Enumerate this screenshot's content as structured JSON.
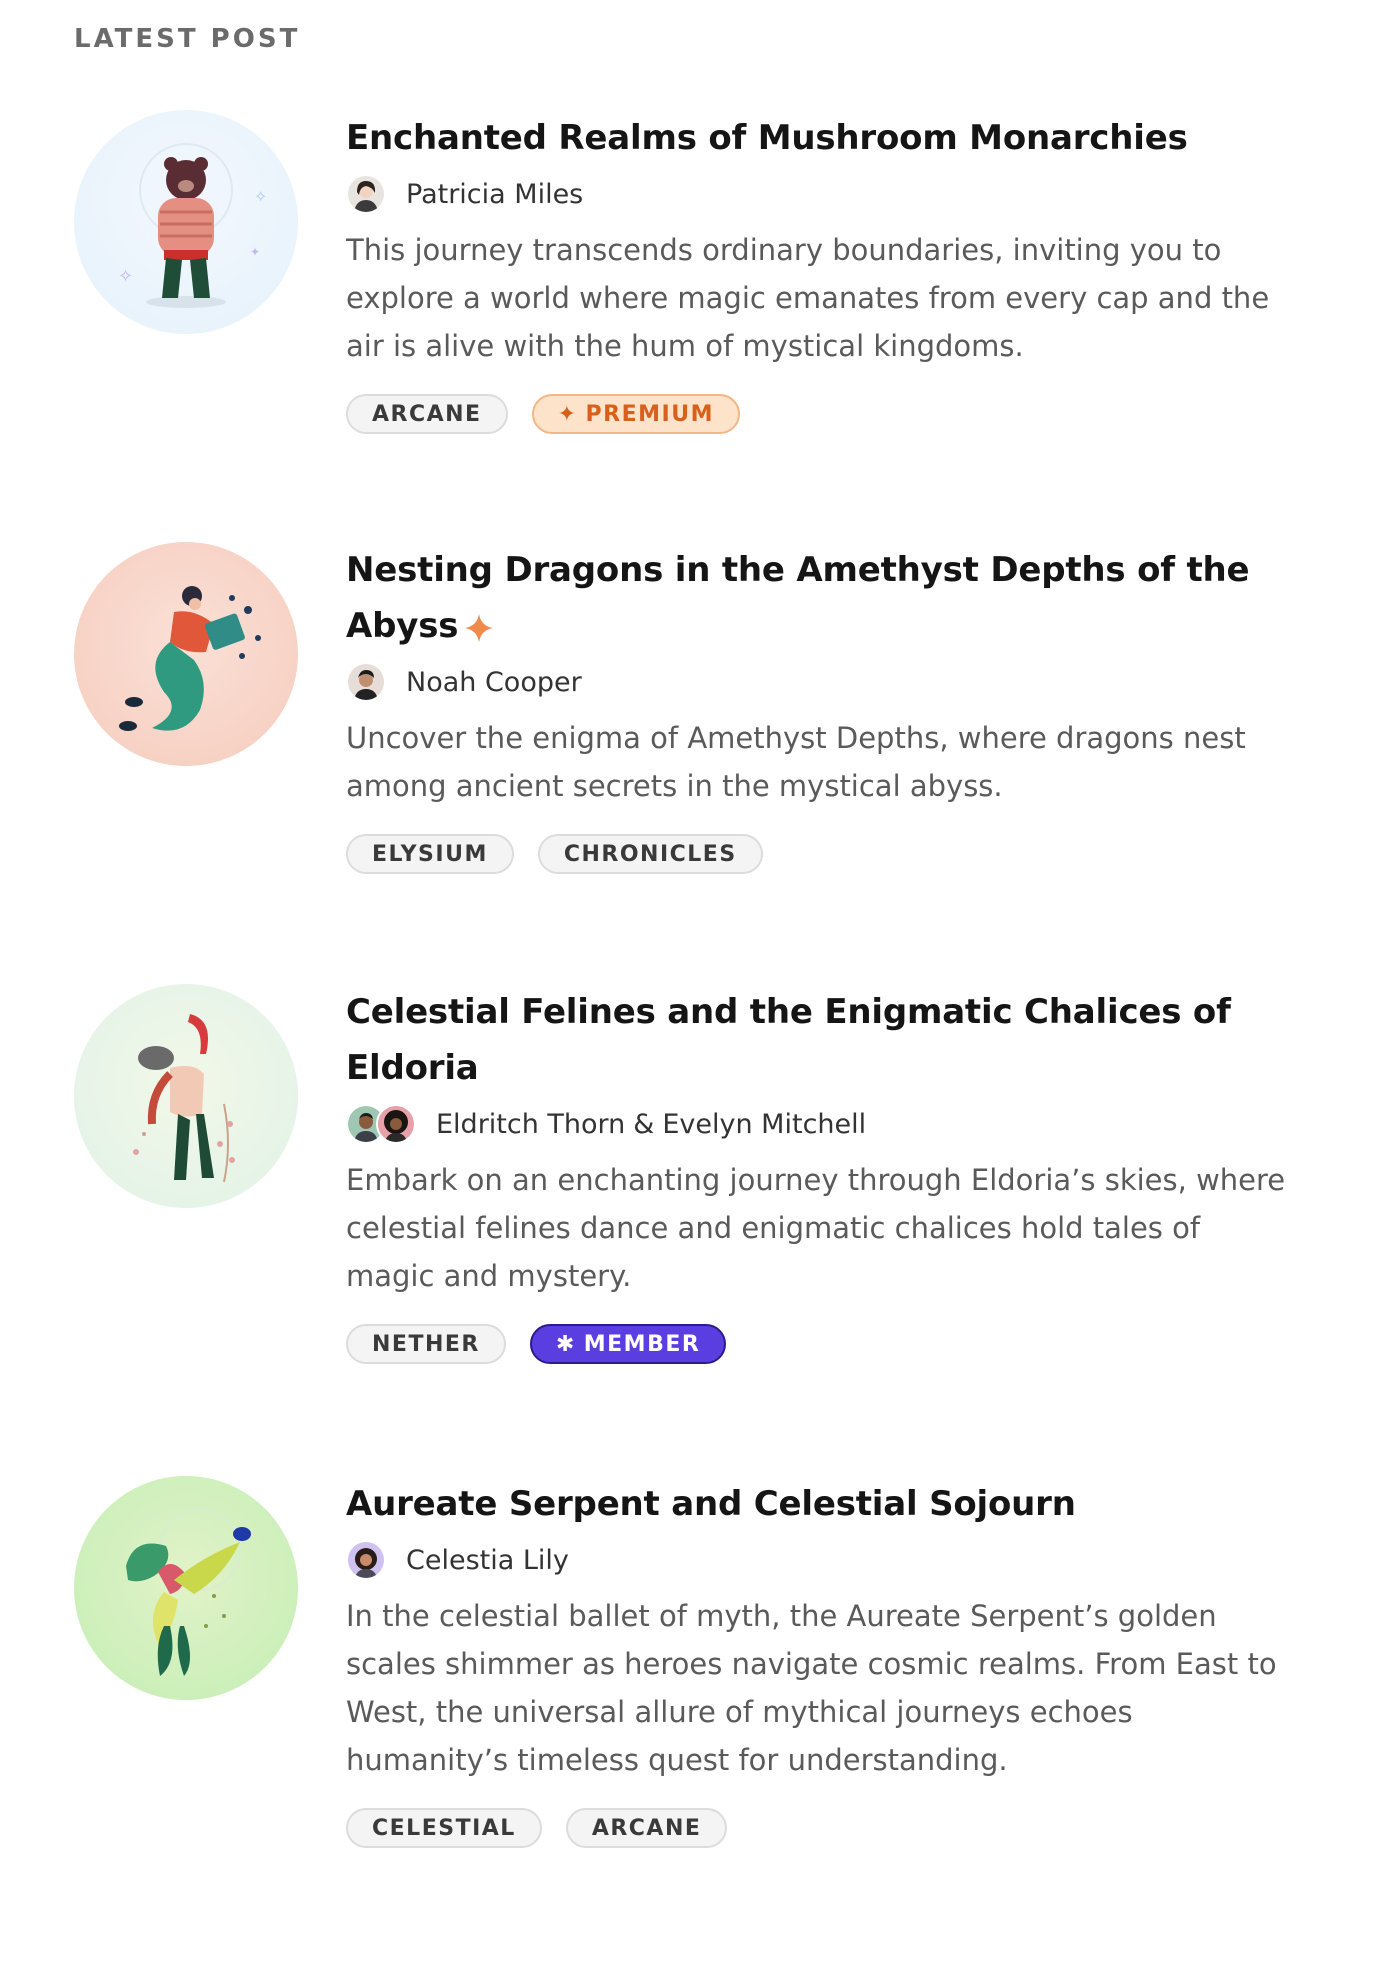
{
  "section": {
    "label": "LATEST POST"
  },
  "posts": [
    {
      "title": "Enchanted Realms of Mushroom Monarchies",
      "featured": false,
      "authors": [
        "Patricia Miles"
      ],
      "excerpt": "This journey transcends ordinary boundaries, inviting you to explore a world where magic emanates from every cap and the air is alive with the hum of mystical kingdoms.",
      "tags": [
        {
          "label": "ARCANE",
          "kind": "default"
        },
        {
          "label": "PREMIUM",
          "kind": "premium",
          "icon": "✦"
        }
      ]
    },
    {
      "title": "Nesting Dragons in the Amethyst Depths of the Abyss",
      "featured": true,
      "authors": [
        "Noah Cooper"
      ],
      "excerpt": "Uncover the enigma of Amethyst Depths, where dragons nest among ancient secrets in the mystical abyss.",
      "tags": [
        {
          "label": "ELYSIUM",
          "kind": "default"
        },
        {
          "label": "CHRONICLES",
          "kind": "default"
        }
      ]
    },
    {
      "title": "Celestial Felines and the Enigmatic Chalices of Eldoria",
      "featured": false,
      "authors": [
        "Eldritch Thorn",
        "Evelyn Mitchell"
      ],
      "author_joiner": "&",
      "excerpt": "Embark on an enchanting journey through Eldoria’s skies, where celestial felines dance and enigmatic chalices hold tales of magic and mystery.",
      "tags": [
        {
          "label": "NETHER",
          "kind": "default"
        },
        {
          "label": "MEMBER",
          "kind": "member",
          "icon": "✱"
        }
      ]
    },
    {
      "title": "Aureate Serpent and Celestial Sojourn",
      "featured": false,
      "authors": [
        "Celestia Lily"
      ],
      "excerpt": "In the celestial ballet of myth, the Aureate Serpent’s golden scales shimmer as heroes navigate cosmic realms. From East to West, the universal allure of mythical journeys echoes humanity’s timeless quest for understanding.",
      "tags": [
        {
          "label": "CELESTIAL",
          "kind": "default"
        },
        {
          "label": "ARCANE",
          "kind": "default"
        }
      ]
    }
  ],
  "colors": {
    "premium_accent": "#d6601c",
    "member_accent": "#5b3ee0",
    "featured_star": "#f08a4b"
  },
  "icons": {
    "featured": "sparkle-star-icon",
    "premium": "sparkle-icon",
    "member": "asterisk-icon"
  }
}
